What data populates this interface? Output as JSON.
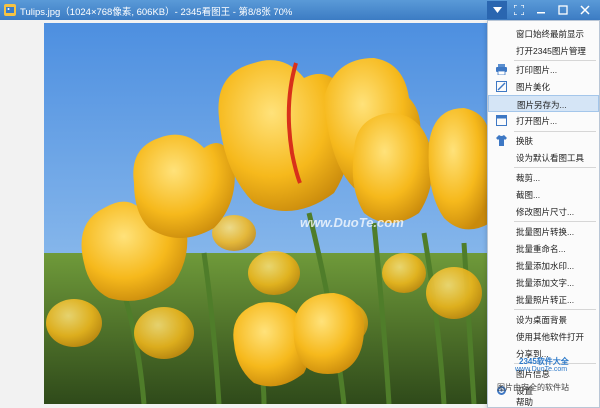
{
  "window": {
    "title": "Tulips.jpg（1024×768像素, 606KB）- 2345看图王 - 第8/8张 70%"
  },
  "watermark": {
    "text": "www.DuoTe.com",
    "site_name": "2345软件大全",
    "site_url": "www.DuoTe.com",
    "footer_text": "图片由安全的软件站"
  },
  "menu": {
    "items": [
      {
        "label": "窗口始终最前显示"
      },
      {
        "label": "打开2345图片管理"
      },
      {
        "label": "打印图片...",
        "icon": "printer-icon"
      },
      {
        "label": "图片美化",
        "icon": "edit-icon"
      },
      {
        "label": "图片另存为...",
        "highlighted": true
      },
      {
        "label": "打开图片...",
        "icon": "open-window-icon"
      },
      {
        "label": "换肤",
        "icon": "skin-shirt-icon"
      },
      {
        "label": "设为默认看图工具"
      },
      {
        "label": "裁剪..."
      },
      {
        "label": "截图..."
      },
      {
        "label": "修改图片尺寸..."
      },
      {
        "label": "批量图片转换..."
      },
      {
        "label": "批量重命名..."
      },
      {
        "label": "批量添加水印..."
      },
      {
        "label": "批量添加文字..."
      },
      {
        "label": "批量照片转正..."
      },
      {
        "label": "设为桌面背景"
      },
      {
        "label": "使用其他软件打开"
      },
      {
        "label": "分享到..."
      },
      {
        "label": "图片信息"
      },
      {
        "label": "设置",
        "icon": "gear-icon"
      },
      {
        "label": "帮助"
      }
    ]
  },
  "colors": {
    "titlebar": "#4a8ad0",
    "menu_highlight": "#d5e5f6",
    "sky": "#6fa8e8",
    "tulip": "#f2b619"
  }
}
